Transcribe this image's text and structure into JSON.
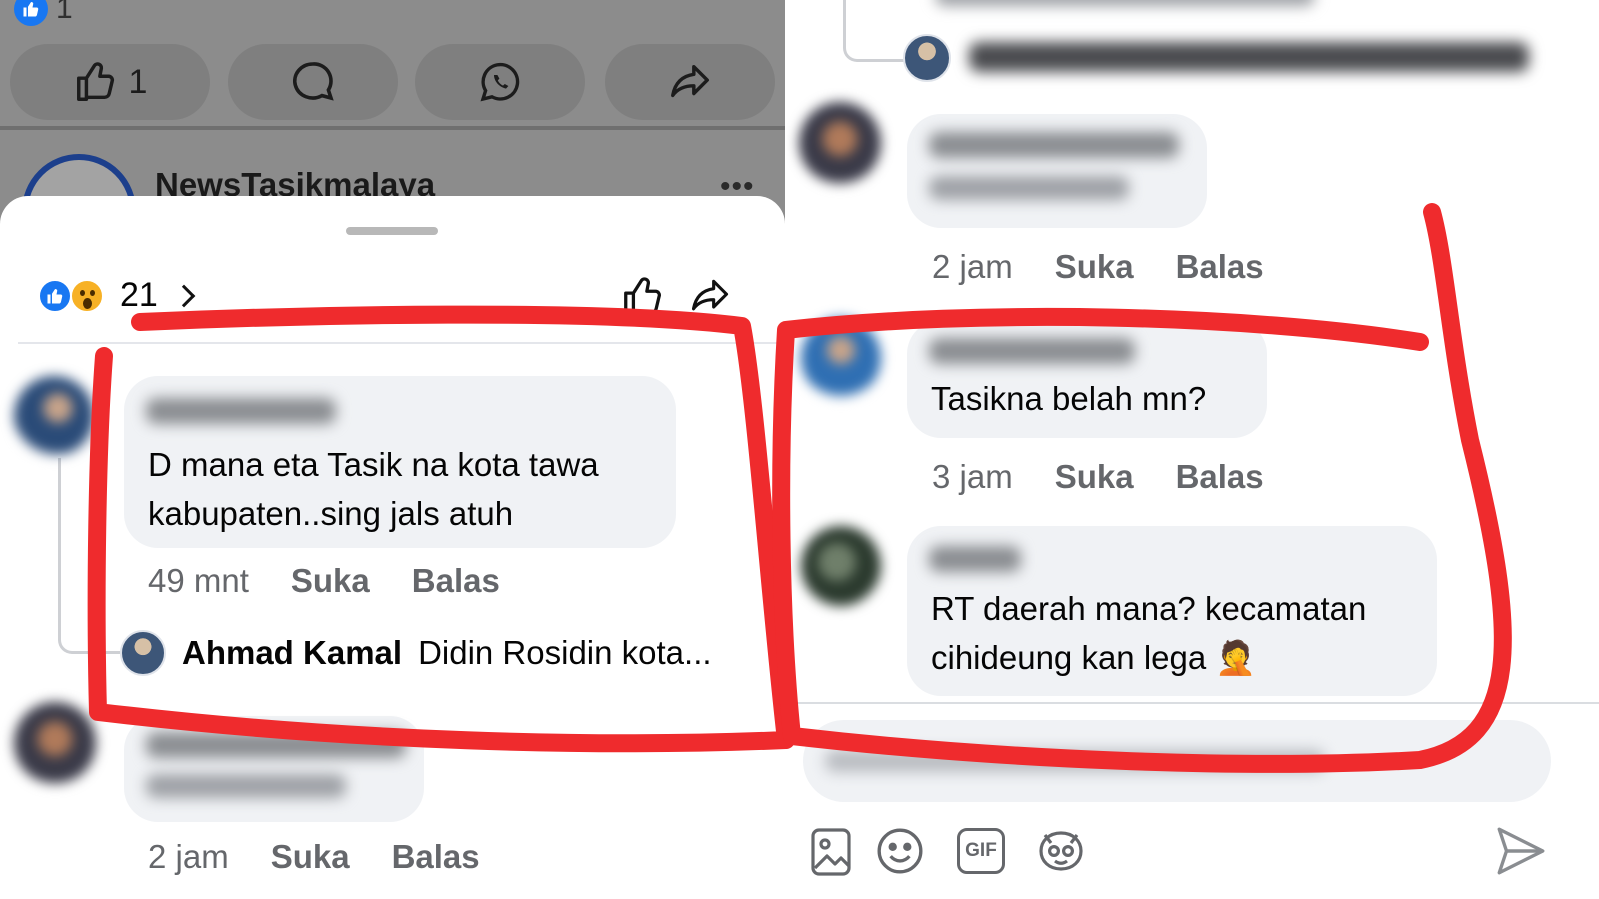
{
  "left": {
    "top_post": {
      "like_count": "1",
      "like_button_count": "1",
      "page_name": "NewsTasikmalaya",
      "more_icon": "more-dots-icon"
    },
    "sheet": {
      "reaction_count": "21",
      "reaction_icons": [
        "like-icon",
        "wow-icon"
      ],
      "comments": [
        {
          "text": "D mana eta Tasik na kota tawa kabupaten..sing jals atuh",
          "time": "49 mnt",
          "like_label": "Suka",
          "reply_label": "Balas",
          "reply_preview": {
            "author": "Ahmad Kamal",
            "text": "Didin Rosidin kota..."
          }
        },
        {
          "time": "2 jam",
          "like_label": "Suka",
          "reply_label": "Balas"
        }
      ]
    }
  },
  "right": {
    "comments": [
      {
        "time": "2 jam",
        "like_label": "Suka",
        "reply_label": "Balas"
      },
      {
        "text": "Tasikna belah mn?",
        "time": "3 jam",
        "like_label": "Suka",
        "reply_label": "Balas"
      },
      {
        "text": "RT daerah mana? kecamatan cihideung kan lega 🤦"
      }
    ],
    "toolbar": [
      "image-icon",
      "emoji-icon",
      "gif-icon",
      "sticker-icon",
      "send-icon"
    ],
    "gif_label": "GIF"
  },
  "colors": {
    "facebook_blue": "#1877f2",
    "bubble_gray": "#f0f2f5",
    "meta_gray": "#65676b",
    "annotation_red": "#ef2b2d"
  }
}
